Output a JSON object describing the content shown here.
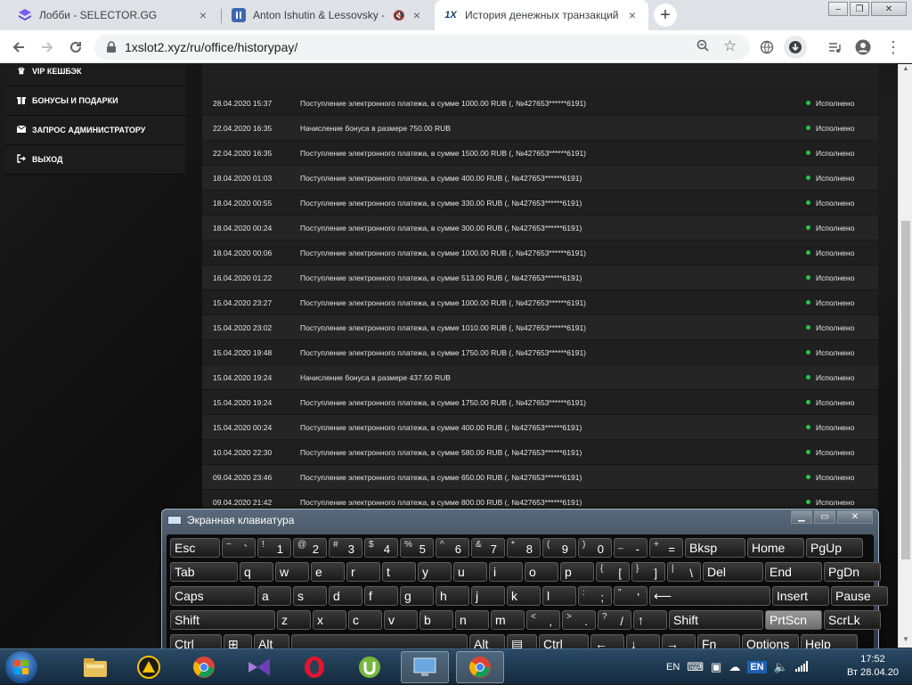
{
  "browser": {
    "tabs": [
      {
        "label": "Лобби - SELECTOR.GG",
        "icon": "selector-logo-icon",
        "close": "×"
      },
      {
        "label": "Anton Ishutin & Lessovsky - ",
        "icon": "pause-icon",
        "close": "×"
      },
      {
        "label": "История денежных транзакций",
        "icon": "1x-logo-icon",
        "close": "×"
      }
    ],
    "new_tab": "+",
    "url": "1xslot2.xyz/ru/office/historypay/",
    "window_controls": {
      "minimize": "–",
      "maximize": "❐",
      "close": "✕"
    }
  },
  "sidebar": {
    "items": [
      {
        "label": "VIP КЕШБЭК",
        "icon": "crown-icon"
      },
      {
        "label": "БОНУСЫ И ПОДАРКИ",
        "icon": "gift-icon"
      },
      {
        "label": "ЗАПРОС АДМИНИСТРАТОРУ",
        "icon": "envelope-icon"
      },
      {
        "label": "ВЫХОД",
        "icon": "logout-icon"
      }
    ]
  },
  "history": {
    "status_color": "#27c54b",
    "rows": [
      {
        "date": "28.04.2020 15:37",
        "desc": "Поступление электронного платежа, в сумме 1000.00 RUB (, №427653******6191)",
        "status": "Исполнено"
      },
      {
        "date": "22.04.2020 16:35",
        "desc": "Начисление бонуса в размере 750.00 RUB",
        "status": "Исполнено"
      },
      {
        "date": "22.04.2020 16:35",
        "desc": "Поступление электронного платежа, в сумме 1500.00 RUB (, №427653******6191)",
        "status": "Исполнено"
      },
      {
        "date": "18.04.2020 01:03",
        "desc": "Поступление электронного платежа, в сумме 400.00 RUB (, №427653******6191)",
        "status": "Исполнено"
      },
      {
        "date": "18.04.2020 00:55",
        "desc": "Поступление электронного платежа, в сумме 330.00 RUB (, №427653******6191)",
        "status": "Исполнено"
      },
      {
        "date": "18.04.2020 00:24",
        "desc": "Поступление электронного платежа, в сумме 300.00 RUB (, №427653******6191)",
        "status": "Исполнено"
      },
      {
        "date": "18.04.2020 00:06",
        "desc": "Поступление электронного платежа, в сумме 1000.00 RUB (, №427653******6191)",
        "status": "Исполнено"
      },
      {
        "date": "16.04.2020 01:22",
        "desc": "Поступление электронного платежа, в сумме 513.00 RUB (, №427653******6191)",
        "status": "Исполнено"
      },
      {
        "date": "15.04.2020 23:27",
        "desc": "Поступление электронного платежа, в сумме 1000.00 RUB (, №427653******6191)",
        "status": "Исполнено"
      },
      {
        "date": "15.04.2020 23:02",
        "desc": "Поступление электронного платежа, в сумме 1010.00 RUB (, №427653******6191)",
        "status": "Исполнено"
      },
      {
        "date": "15.04.2020 19:48",
        "desc": "Поступление электронного платежа, в сумме 1750.00 RUB (, №427653******6191)",
        "status": "Исполнено"
      },
      {
        "date": "15.04.2020 19:24",
        "desc": "Начисление бонуса в размере 437.50 RUB",
        "status": "Исполнено"
      },
      {
        "date": "15.04.2020 19:24",
        "desc": "Поступление электронного платежа, в сумме 1750.00 RUB (, №427653******6191)",
        "status": "Исполнено"
      },
      {
        "date": "15.04.2020 00:24",
        "desc": "Поступление электронного платежа, в сумме 400.00 RUB (, №427653******6191)",
        "status": "Исполнено"
      },
      {
        "date": "10.04.2020 22:30",
        "desc": "Поступление электронного платежа, в сумме 580.00 RUB (, №427653******6191)",
        "status": "Исполнено"
      },
      {
        "date": "09.04.2020 23:46",
        "desc": "Поступление электронного платежа, в сумме 650.00 RUB (, №427653******6191)",
        "status": "Исполнено"
      },
      {
        "date": "09.04.2020 21:42",
        "desc": "Поступление электронного платежа, в сумме 800.00 RUB (, №427653******6191)",
        "status": "Исполнено"
      }
    ]
  },
  "osk": {
    "title": "Экранная клавиатура",
    "controls": {
      "minimize": "▁",
      "restore": "▭",
      "close": "✕"
    },
    "rows": [
      [
        {
          "label": "Esc"
        },
        {
          "top": "~",
          "main": "`"
        },
        {
          "top": "!",
          "main": "1"
        },
        {
          "top": "@",
          "main": "2"
        },
        {
          "top": "#",
          "main": "3"
        },
        {
          "top": "$",
          "main": "4"
        },
        {
          "top": "%",
          "main": "5"
        },
        {
          "top": "^",
          "main": "6"
        },
        {
          "top": "&",
          "main": "7"
        },
        {
          "top": "*",
          "main": "8"
        },
        {
          "top": "(",
          "main": "9"
        },
        {
          "top": ")",
          "main": "0"
        },
        {
          "top": "_",
          "main": "-"
        },
        {
          "top": "+",
          "main": "="
        },
        {
          "label": "Bksp"
        },
        {
          "label": "Home"
        },
        {
          "label": "PgUp"
        }
      ],
      [
        {
          "label": "Tab"
        },
        {
          "label": "q"
        },
        {
          "label": "w"
        },
        {
          "label": "e"
        },
        {
          "label": "r"
        },
        {
          "label": "t"
        },
        {
          "label": "y"
        },
        {
          "label": "u"
        },
        {
          "label": "i"
        },
        {
          "label": "o"
        },
        {
          "label": "p"
        },
        {
          "top": "{",
          "main": "["
        },
        {
          "top": "}",
          "main": "]"
        },
        {
          "top": "|",
          "main": "\\"
        },
        {
          "label": "Del"
        },
        {
          "label": "End"
        },
        {
          "label": "PgDn"
        }
      ],
      [
        {
          "label": "Caps"
        },
        {
          "label": "a"
        },
        {
          "label": "s"
        },
        {
          "label": "d"
        },
        {
          "label": "f"
        },
        {
          "label": "g"
        },
        {
          "label": "h"
        },
        {
          "label": "j"
        },
        {
          "label": "k"
        },
        {
          "label": "l"
        },
        {
          "top": ":",
          "main": ";"
        },
        {
          "top": "\"",
          "main": "'"
        },
        {
          "label": "⟵"
        },
        {
          "label": "Insert"
        },
        {
          "label": "Pause"
        }
      ],
      [
        {
          "label": "Shift"
        },
        {
          "label": "z"
        },
        {
          "label": "x"
        },
        {
          "label": "c"
        },
        {
          "label": "v"
        },
        {
          "label": "b"
        },
        {
          "label": "n"
        },
        {
          "label": "m"
        },
        {
          "top": "<",
          "main": ","
        },
        {
          "top": ">",
          "main": "."
        },
        {
          "top": "?",
          "main": "/"
        },
        {
          "label": "↑"
        },
        {
          "label": "Shift"
        },
        {
          "label": "PrtScn"
        },
        {
          "label": "ScrLk"
        }
      ],
      [
        {
          "label": "Ctrl"
        },
        {
          "label": "⊞"
        },
        {
          "label": "Alt"
        },
        {
          "label": ""
        },
        {
          "label": "Alt"
        },
        {
          "label": "▤"
        },
        {
          "label": "Ctrl"
        },
        {
          "label": "←"
        },
        {
          "label": "↓"
        },
        {
          "label": "→"
        },
        {
          "label": "Fn"
        },
        {
          "label": "Options"
        },
        {
          "label": "Help"
        }
      ]
    ]
  },
  "taskbar": {
    "apps": [
      "explorer-icon",
      "avast-icon",
      "chrome-icon",
      "visual-studio-icon",
      "opera-icon",
      "utorrent-icon",
      "remote-desktop-icon",
      "chrome-active-icon"
    ],
    "lang": "EN",
    "lang_badge": "EN",
    "time": "17:52",
    "date": "Вт 28.04.20"
  }
}
